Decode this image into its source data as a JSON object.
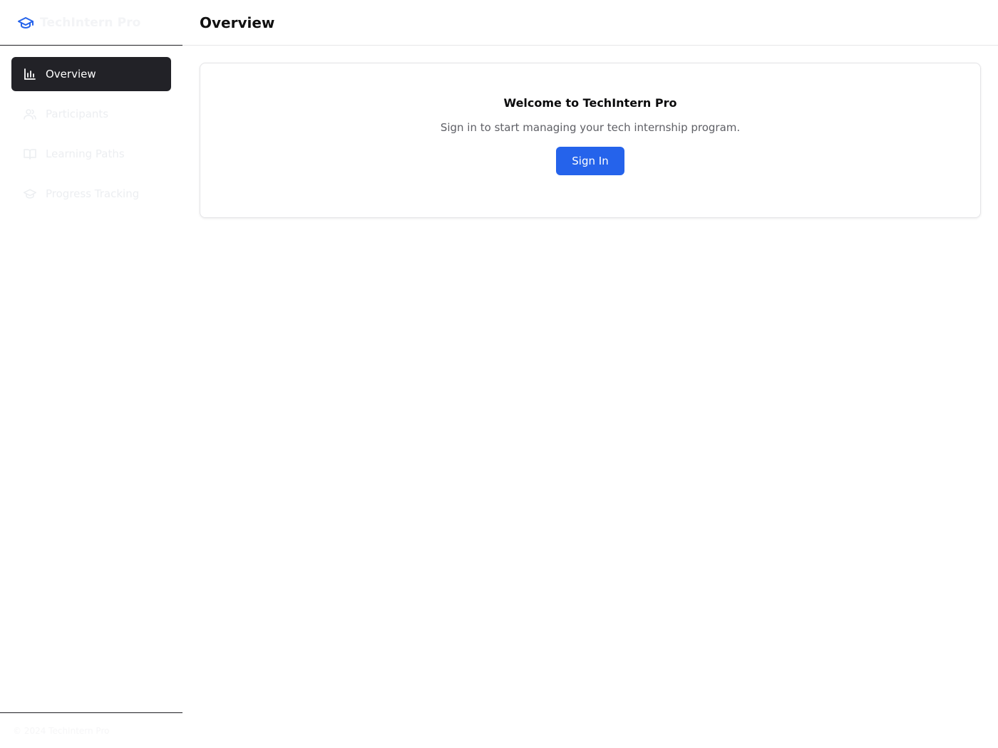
{
  "brand": {
    "name": "TechIntern Pro",
    "icon": "graduation-cap-icon",
    "icon_color": "#2563eb"
  },
  "sidebar": {
    "items": [
      {
        "label": "Overview",
        "icon": "bar-chart-icon",
        "active": true
      },
      {
        "label": "Participants",
        "icon": "users-icon",
        "active": false
      },
      {
        "label": "Learning Paths",
        "icon": "book-open-icon",
        "active": false
      },
      {
        "label": "Progress Tracking",
        "icon": "graduation-cap-icon",
        "active": false
      }
    ],
    "footer_text": "© 2024 TechIntern Pro"
  },
  "header": {
    "title": "Overview"
  },
  "welcome_card": {
    "title": "Welcome to TechIntern Pro",
    "subtitle": "Sign in to start managing your tech internship program.",
    "sign_in_label": "Sign In"
  },
  "colors": {
    "accent": "#2563eb",
    "active_nav_bg": "#222227"
  }
}
